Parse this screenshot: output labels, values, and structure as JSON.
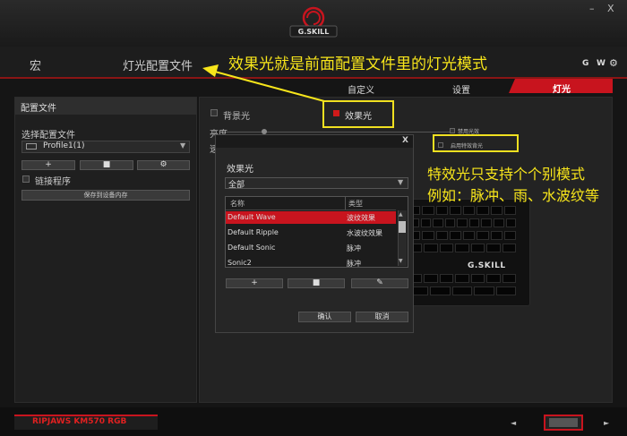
{
  "window": {
    "brand_logo": "G.SKILL",
    "minimize_label": "–",
    "close_label": "X"
  },
  "nav": {
    "macro_label": "宏",
    "profile_label": "灯光配置文件",
    "g_label": "G",
    "w_label": "W",
    "gear_icon": "gear-icon"
  },
  "tabs": [
    {
      "label": "自定义"
    },
    {
      "label": "设置"
    },
    {
      "label": "灯光",
      "active": true
    }
  ],
  "left_panel": {
    "title": "配置文件",
    "select_label": "选择配置文件",
    "profile_value": "Profile1(1)",
    "add_label": "+",
    "delete_label": "■",
    "settings_label": "⚙",
    "link_program_label": "链接程序",
    "save_device_label": "保存到设备内存"
  },
  "main": {
    "background_light_label": "背景光",
    "effect_light_label": "效果光",
    "brightness_label": "亮度",
    "speed_label": "速",
    "disable_effect_label": "禁用光效",
    "special_effect_bg_label": "启用特效背光"
  },
  "dialog": {
    "close_label": "X",
    "section_label": "效果光",
    "filter_value": "全部",
    "columns": [
      "名称",
      "类型"
    ],
    "rows": [
      {
        "name": "Default Wave",
        "type": "波纹效果",
        "selected": true
      },
      {
        "name": "Default Ripple",
        "type": "水波纹效果"
      },
      {
        "name": "Default Sonic",
        "type": "脉冲"
      },
      {
        "name": "Sonic2",
        "type": "脉冲"
      }
    ],
    "add_label": "+",
    "delete_label": "■",
    "edit_label": "✎",
    "ok_label": "确认",
    "cancel_label": "取消"
  },
  "keyboard": {
    "brand": "G.SKILL"
  },
  "annotations": {
    "note1": "效果光就是前面配置文件里的灯光模式",
    "note2a": "特效光只支持个个别模式",
    "note2b": "例如：脉冲、雨、水波纹等"
  },
  "footer": {
    "model_name": "RIPJAWS KM570 RGB",
    "prev_label": "◄",
    "next_label": "►"
  },
  "colors": {
    "accent_red": "#c8141e",
    "annotation_yellow": "#f7e51b"
  }
}
